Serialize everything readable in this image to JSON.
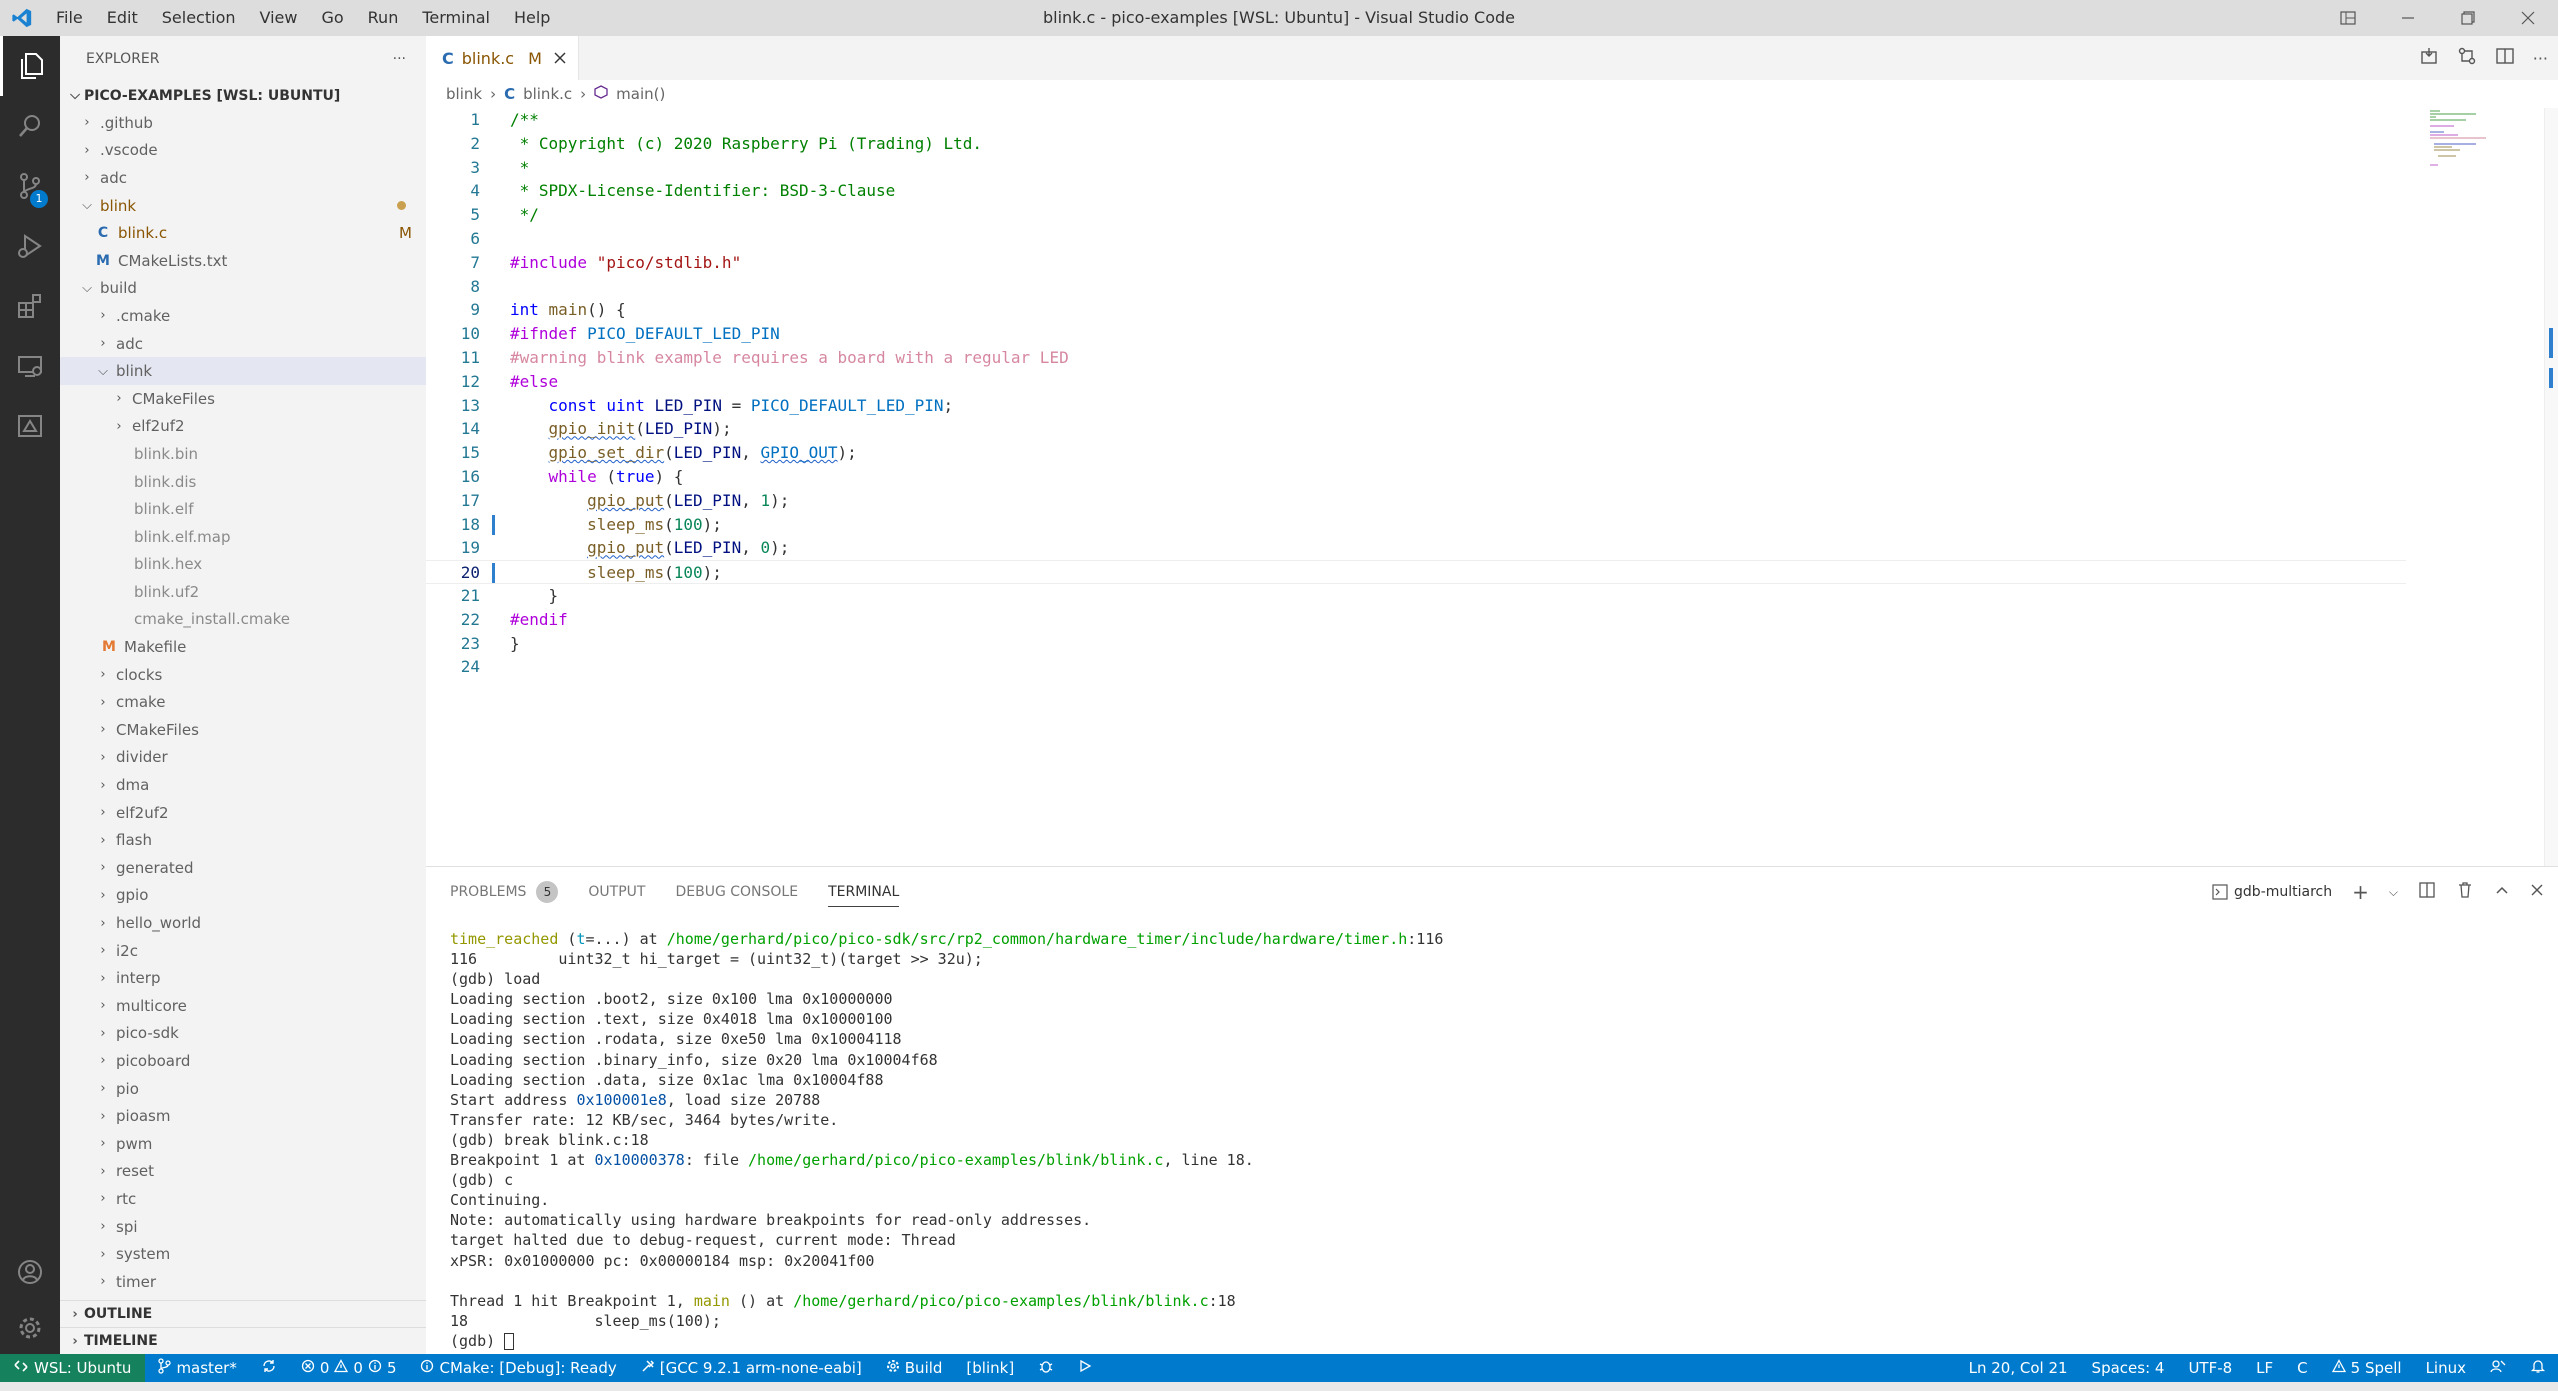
{
  "title_bar": {
    "menu": [
      "File",
      "Edit",
      "Selection",
      "View",
      "Go",
      "Run",
      "Terminal",
      "Help"
    ],
    "window_title": "blink.c - pico-examples [WSL: Ubuntu] - Visual Studio Code"
  },
  "activity_bar": {
    "scm_badge": "1"
  },
  "sidebar": {
    "header": "EXPLORER",
    "more": "···",
    "root": "PICO-EXAMPLES [WSL: UBUNTU]",
    "items": [
      {
        "label": ".github",
        "kind": "folder"
      },
      {
        "label": ".vscode",
        "kind": "folder"
      },
      {
        "label": "adc",
        "kind": "folder"
      },
      {
        "label": "blink",
        "kind": "folder-open",
        "modified": true
      },
      {
        "label": "blink.c",
        "kind": "c-file",
        "badge": "M"
      },
      {
        "label": "CMakeLists.txt",
        "kind": "m-file"
      },
      {
        "label": "build",
        "kind": "folder-open"
      },
      {
        "label": ".cmake",
        "kind": "folder"
      },
      {
        "label": "adc",
        "kind": "folder"
      },
      {
        "label": "blink",
        "kind": "folder-open",
        "selected": true
      },
      {
        "label": "CMakeFiles",
        "kind": "folder"
      },
      {
        "label": "elf2uf2",
        "kind": "folder"
      },
      {
        "label": "blink.bin",
        "kind": "file"
      },
      {
        "label": "blink.dis",
        "kind": "file"
      },
      {
        "label": "blink.elf",
        "kind": "file"
      },
      {
        "label": "blink.elf.map",
        "kind": "file"
      },
      {
        "label": "blink.hex",
        "kind": "file"
      },
      {
        "label": "blink.uf2",
        "kind": "file"
      },
      {
        "label": "cmake_install.cmake",
        "kind": "file"
      },
      {
        "label": "Makefile",
        "kind": "make-file"
      },
      {
        "label": "clocks",
        "kind": "folder"
      },
      {
        "label": "cmake",
        "kind": "folder"
      },
      {
        "label": "CMakeFiles",
        "kind": "folder"
      },
      {
        "label": "divider",
        "kind": "folder"
      },
      {
        "label": "dma",
        "kind": "folder"
      },
      {
        "label": "elf2uf2",
        "kind": "folder"
      },
      {
        "label": "flash",
        "kind": "folder"
      },
      {
        "label": "generated",
        "kind": "folder"
      },
      {
        "label": "gpio",
        "kind": "folder"
      },
      {
        "label": "hello_world",
        "kind": "folder"
      },
      {
        "label": "i2c",
        "kind": "folder"
      },
      {
        "label": "interp",
        "kind": "folder"
      },
      {
        "label": "multicore",
        "kind": "folder"
      },
      {
        "label": "pico-sdk",
        "kind": "folder"
      },
      {
        "label": "picoboard",
        "kind": "folder"
      },
      {
        "label": "pio",
        "kind": "folder"
      },
      {
        "label": "pioasm",
        "kind": "folder"
      },
      {
        "label": "pwm",
        "kind": "folder"
      },
      {
        "label": "reset",
        "kind": "folder"
      },
      {
        "label": "rtc",
        "kind": "folder"
      },
      {
        "label": "spi",
        "kind": "folder"
      },
      {
        "label": "system",
        "kind": "folder"
      },
      {
        "label": "timer",
        "kind": "folder"
      }
    ],
    "outline": "OUTLINE",
    "timeline": "TIMELINE"
  },
  "editor": {
    "tab": {
      "icon": "C",
      "name": "blink.c",
      "status": "M"
    },
    "breadcrumb": [
      "blink",
      "blink.c",
      "main()"
    ],
    "breadcrumb_c_icon": "C",
    "line_numbers": [
      "1",
      "2",
      "3",
      "4",
      "5",
      "6",
      "7",
      "8",
      "9",
      "10",
      "11",
      "12",
      "13",
      "14",
      "15",
      "16",
      "17",
      "18",
      "19",
      "20",
      "21",
      "22",
      "23",
      "24"
    ]
  },
  "panel": {
    "tabs": [
      "PROBLEMS",
      "OUTPUT",
      "DEBUG CONSOLE",
      "TERMINAL"
    ],
    "problems_count": "5",
    "terminal_name": "gdb-multiarch"
  },
  "status_bar": {
    "remote": "WSL: Ubuntu",
    "branch": "master*",
    "errors": "0",
    "warnings": "0",
    "info": "5",
    "cmake": "CMake: [Debug]: Ready",
    "kit": "[GCC 9.2.1 arm-none-eabi]",
    "build": "Build",
    "target": "[blink]",
    "position": "Ln 20, Col 21",
    "spaces": "Spaces: 4",
    "encoding": "UTF-8",
    "eol": "LF",
    "language": "C",
    "spell": "5 Spell",
    "os": "Linux"
  },
  "colors": {
    "status_bar": "#007acc",
    "remote": "#16825d",
    "activity_bar": "#2c2c2c",
    "sidebar": "#f3f3f3",
    "title_bar": "#dddddd"
  }
}
